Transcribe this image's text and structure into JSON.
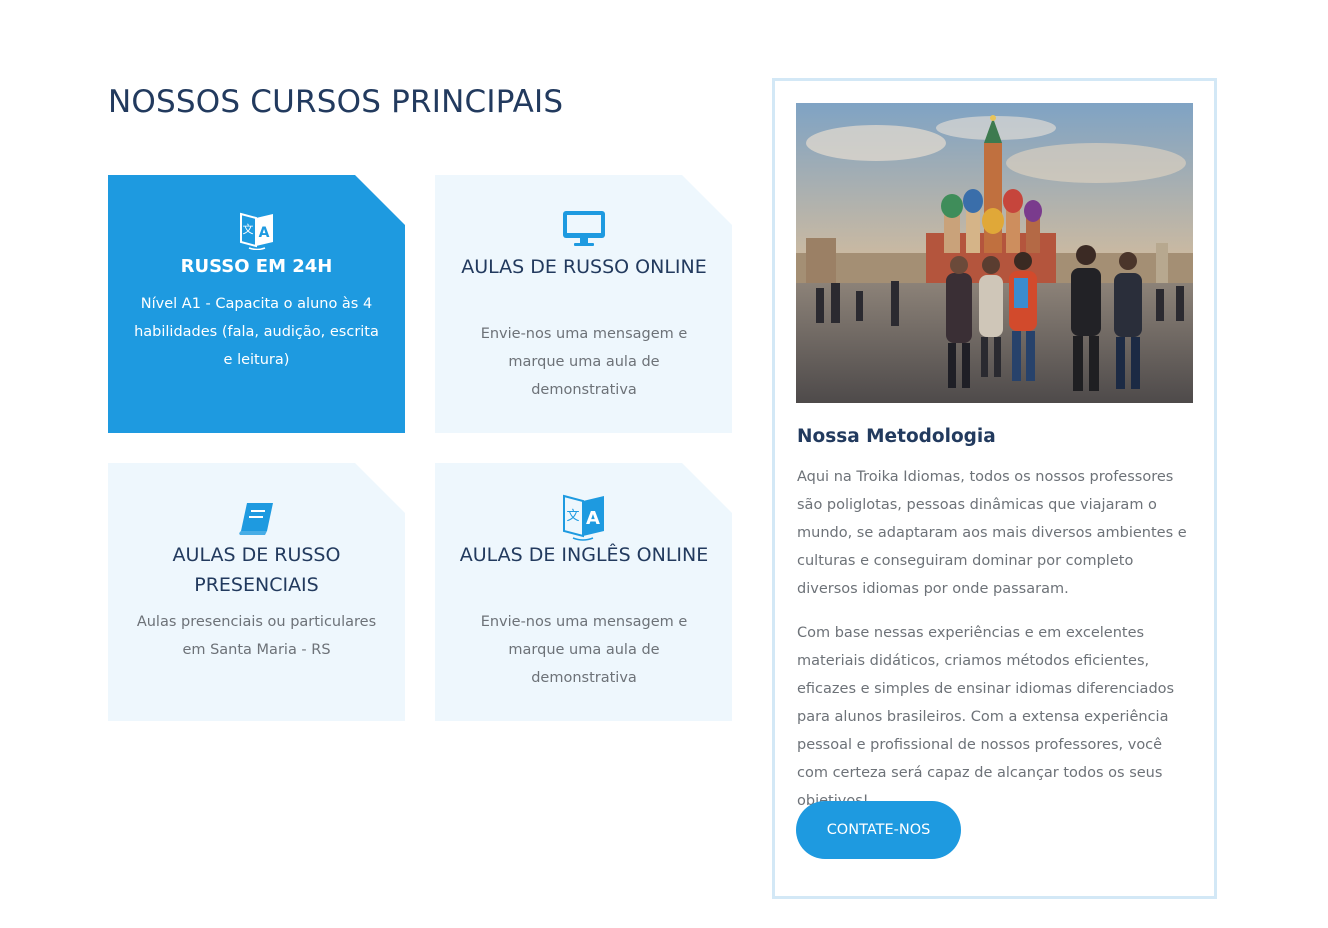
{
  "section": {
    "title": "NOSSOS CURSOS PRINCIPAIS"
  },
  "courses": [
    {
      "title": "RUSSO EM 24H",
      "text": "Nível A1 - Capacita o aluno às 4 habilidades (fala, audição, escrita e leitura)",
      "icon": "translate-icon",
      "active": true
    },
    {
      "title": "AULAS DE RUSSO ONLINE",
      "text": "Envie-nos uma mensagem e marque uma aula de demonstrativa",
      "icon": "monitor-icon",
      "active": false
    },
    {
      "title": "AULAS DE RUSSO PRESENCIAIS",
      "text": "Aulas presenciais ou particulares em Santa Maria - RS",
      "icon": "book-icon",
      "active": false
    },
    {
      "title": "AULAS DE INGLÊS ONLINE",
      "text": "Envie-nos uma mensagem e marque uma aula de demonstrativa",
      "icon": "translate-icon",
      "active": false
    }
  ],
  "sidebar": {
    "heading": "Nossa Metodologia",
    "paragraph_1": "Aqui na Troika Idiomas, todos os nossos professores são poliglotas, pessoas dinâmicas que viajaram o mundo, se adaptaram aos mais diversos ambientes e culturas e conseguiram dominar por completo diversos idiomas por onde passaram.",
    "paragraph_2": "Com base nessas experiências e em excelentes materiais didáticos, criamos métodos eficientes, eficazes e simples de ensinar idiomas diferenciados para alunos brasileiros. Com a extensa experiência pessoal e profissional de nossos professores, você com certeza será capaz de alcançar todos os seus objetivos!",
    "button_label": "CONTATE-NOS"
  },
  "colors": {
    "accent": "#1e9ae0",
    "heading": "#223a5e",
    "card_bg": "#eef7fd",
    "body_text": "#6d7278",
    "border": "#d3e8f6"
  }
}
